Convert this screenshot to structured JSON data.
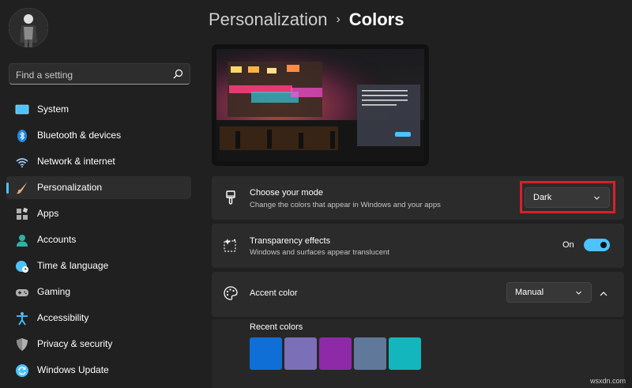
{
  "sidebar": {
    "search": {
      "placeholder": "Find a setting",
      "icon": "search-icon"
    },
    "items": [
      {
        "label": "System",
        "icon": "monitor-icon",
        "color": "#4cc2ff"
      },
      {
        "label": "Bluetooth & devices",
        "icon": "bluetooth-icon",
        "color": "#1e88e5"
      },
      {
        "label": "Network & internet",
        "icon": "wifi-icon",
        "color": "#9ecbff"
      },
      {
        "label": "Personalization",
        "icon": "brush-icon",
        "color": "#e8a87c",
        "active": true
      },
      {
        "label": "Apps",
        "icon": "apps-icon",
        "color": "#b0b0b0"
      },
      {
        "label": "Accounts",
        "icon": "person-icon",
        "color": "#2fb1a5"
      },
      {
        "label": "Time & language",
        "icon": "globe-clock-icon",
        "color": "#4cc2ff"
      },
      {
        "label": "Gaming",
        "icon": "gamepad-icon",
        "color": "#b0b0b0"
      },
      {
        "label": "Accessibility",
        "icon": "accessibility-icon",
        "color": "#4cc2ff"
      },
      {
        "label": "Privacy & security",
        "icon": "shield-icon",
        "color": "#b0b0b0"
      },
      {
        "label": "Windows Update",
        "icon": "update-icon",
        "color": "#4cc2ff"
      }
    ]
  },
  "header": {
    "parent": "Personalization",
    "separator": "›",
    "current": "Colors"
  },
  "mode": {
    "title": "Choose your mode",
    "description": "Change the colors that appear in Windows and your apps",
    "value": "Dark",
    "icon": "paint-brush-icon"
  },
  "transparency": {
    "title": "Transparency effects",
    "description": "Windows and surfaces appear translucent",
    "state_label": "On",
    "enabled": true,
    "icon": "sparkle-icon"
  },
  "accent": {
    "title": "Accent color",
    "value": "Manual",
    "icon": "palette-icon",
    "recent_label": "Recent colors",
    "recent_colors": [
      "#0f6fd6",
      "#7b6fb8",
      "#8e2aa8",
      "#60789a",
      "#14b6bd"
    ]
  },
  "theme": {
    "accent": "#4cc2ff",
    "highlight": "#d7202c"
  },
  "watermark": "wsxdn.com"
}
